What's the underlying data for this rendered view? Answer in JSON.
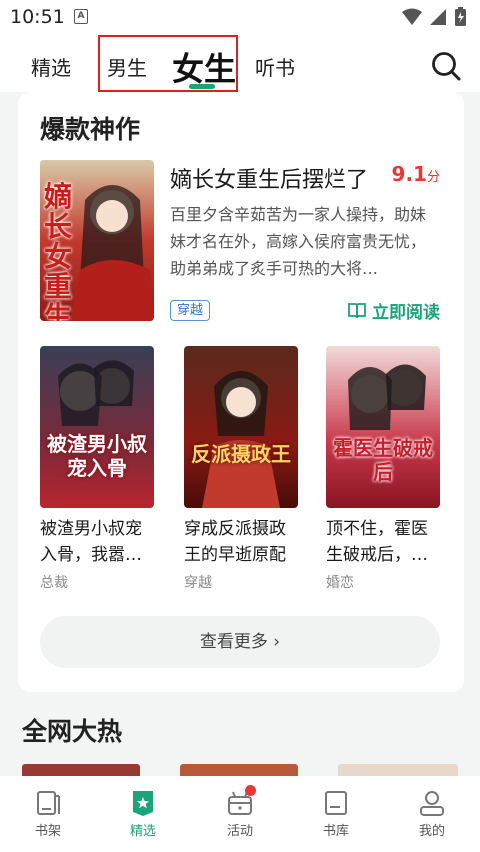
{
  "status_bar": {
    "time": "10:51",
    "notif_letter": "A"
  },
  "top_nav": {
    "tabs": [
      {
        "label": "精选"
      },
      {
        "label": "男生"
      },
      {
        "label": "女生",
        "active": true
      },
      {
        "label": "听书"
      }
    ],
    "accent_color": "#1ba37a",
    "highlight_box_color": "#e02020",
    "search_icon": "search-icon"
  },
  "hot_section": {
    "title": "爆款神作",
    "featured": {
      "title": "嫡长女重生后摆烂了",
      "score": "9.1",
      "score_unit": "分",
      "description": "百里夕含辛茹苦为一家人操持，助妹妹才名在外，高嫁入侯府富贵无忧，助弟弟成了炙手可热的大将…",
      "tag": "穿越",
      "read_label": "立即阅读",
      "cover_text": "嫡长女重生后"
    },
    "books": [
      {
        "title": "被渣男小叔宠入骨，我嚣…",
        "category": "总裁",
        "cover_text": "被渣男小叔宠入骨"
      },
      {
        "title": "穿成反派摄政王的早逝原配",
        "category": "穿越",
        "cover_text": "反派摄政王"
      },
      {
        "title": "顶不住，霍医生破戒后，…",
        "category": "婚恋",
        "cover_text": "霍医生破戒后"
      }
    ],
    "more_label": "查看更多 ›"
  },
  "trending_section": {
    "title": "全网大热"
  },
  "bottom_nav": [
    {
      "label": "书架",
      "icon": "bookshelf-icon"
    },
    {
      "label": "精选",
      "icon": "featured-icon",
      "active": true
    },
    {
      "label": "活动",
      "icon": "gift-icon",
      "badge": true
    },
    {
      "label": "书库",
      "icon": "library-icon"
    },
    {
      "label": "我的",
      "icon": "profile-icon"
    }
  ]
}
